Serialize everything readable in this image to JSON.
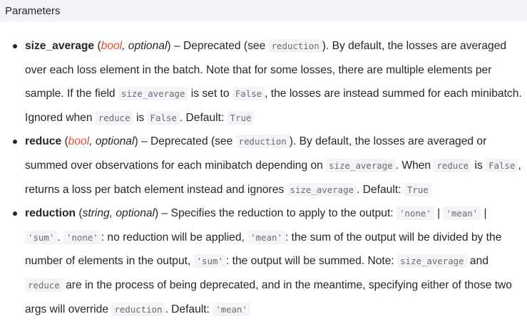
{
  "header": {
    "title": "Parameters"
  },
  "params": [
    {
      "name": "size_average",
      "type_link": "bool",
      "type_rest": ", optional",
      "segments": [
        {
          "t": "text",
          "v": " – Deprecated (see "
        },
        {
          "t": "code",
          "v": "reduction"
        },
        {
          "t": "text",
          "v": "). By default, the losses are averaged over each loss element in the batch. Note that for some losses, there are multiple elements per sample. If the field "
        },
        {
          "t": "code",
          "v": "size_average"
        },
        {
          "t": "text",
          "v": " is set to "
        },
        {
          "t": "code",
          "v": "False"
        },
        {
          "t": "text",
          "v": ", the losses are instead summed for each minibatch. Ignored when "
        },
        {
          "t": "code",
          "v": "reduce"
        },
        {
          "t": "text",
          "v": " is "
        },
        {
          "t": "code",
          "v": "False"
        },
        {
          "t": "text",
          "v": ". Default: "
        },
        {
          "t": "code",
          "v": "True"
        }
      ]
    },
    {
      "name": "reduce",
      "type_link": "bool",
      "type_rest": ", optional",
      "segments": [
        {
          "t": "text",
          "v": " – Deprecated (see "
        },
        {
          "t": "code",
          "v": "reduction"
        },
        {
          "t": "text",
          "v": "). By default, the losses are averaged or summed over observations for each minibatch depending on "
        },
        {
          "t": "code",
          "v": "size_average"
        },
        {
          "t": "text",
          "v": ". When "
        },
        {
          "t": "code",
          "v": "reduce"
        },
        {
          "t": "text",
          "v": " is "
        },
        {
          "t": "code",
          "v": "False"
        },
        {
          "t": "text",
          "v": ", returns a loss per batch element instead and ignores "
        },
        {
          "t": "code",
          "v": "size_average"
        },
        {
          "t": "text",
          "v": ". Default: "
        },
        {
          "t": "code",
          "v": "True"
        }
      ]
    },
    {
      "name": "reduction",
      "type_link": "",
      "type_rest": "string, optional",
      "segments": [
        {
          "t": "text",
          "v": " – Specifies the reduction to apply to the output: "
        },
        {
          "t": "code",
          "v": "'none'"
        },
        {
          "t": "text",
          "v": " | "
        },
        {
          "t": "code",
          "v": "'mean'"
        },
        {
          "t": "text",
          "v": " | "
        },
        {
          "t": "code",
          "v": "'sum'"
        },
        {
          "t": "text",
          "v": ". "
        },
        {
          "t": "code",
          "v": "'none'"
        },
        {
          "t": "text",
          "v": ": no reduction will be applied, "
        },
        {
          "t": "code",
          "v": "'mean'"
        },
        {
          "t": "text",
          "v": ": the sum of the output will be divided by the number of elements in the output, "
        },
        {
          "t": "code",
          "v": "'sum'"
        },
        {
          "t": "text",
          "v": ": the output will be summed. Note: "
        },
        {
          "t": "code",
          "v": "size_average"
        },
        {
          "t": "text",
          "v": " and "
        },
        {
          "t": "code",
          "v": "reduce"
        },
        {
          "t": "text",
          "v": " are in the process of being deprecated, and in the meantime, specifying either of those two args will override "
        },
        {
          "t": "code",
          "v": "reduction"
        },
        {
          "t": "text",
          "v": ". Default: "
        },
        {
          "t": "code",
          "v": "'mean'"
        }
      ]
    }
  ]
}
